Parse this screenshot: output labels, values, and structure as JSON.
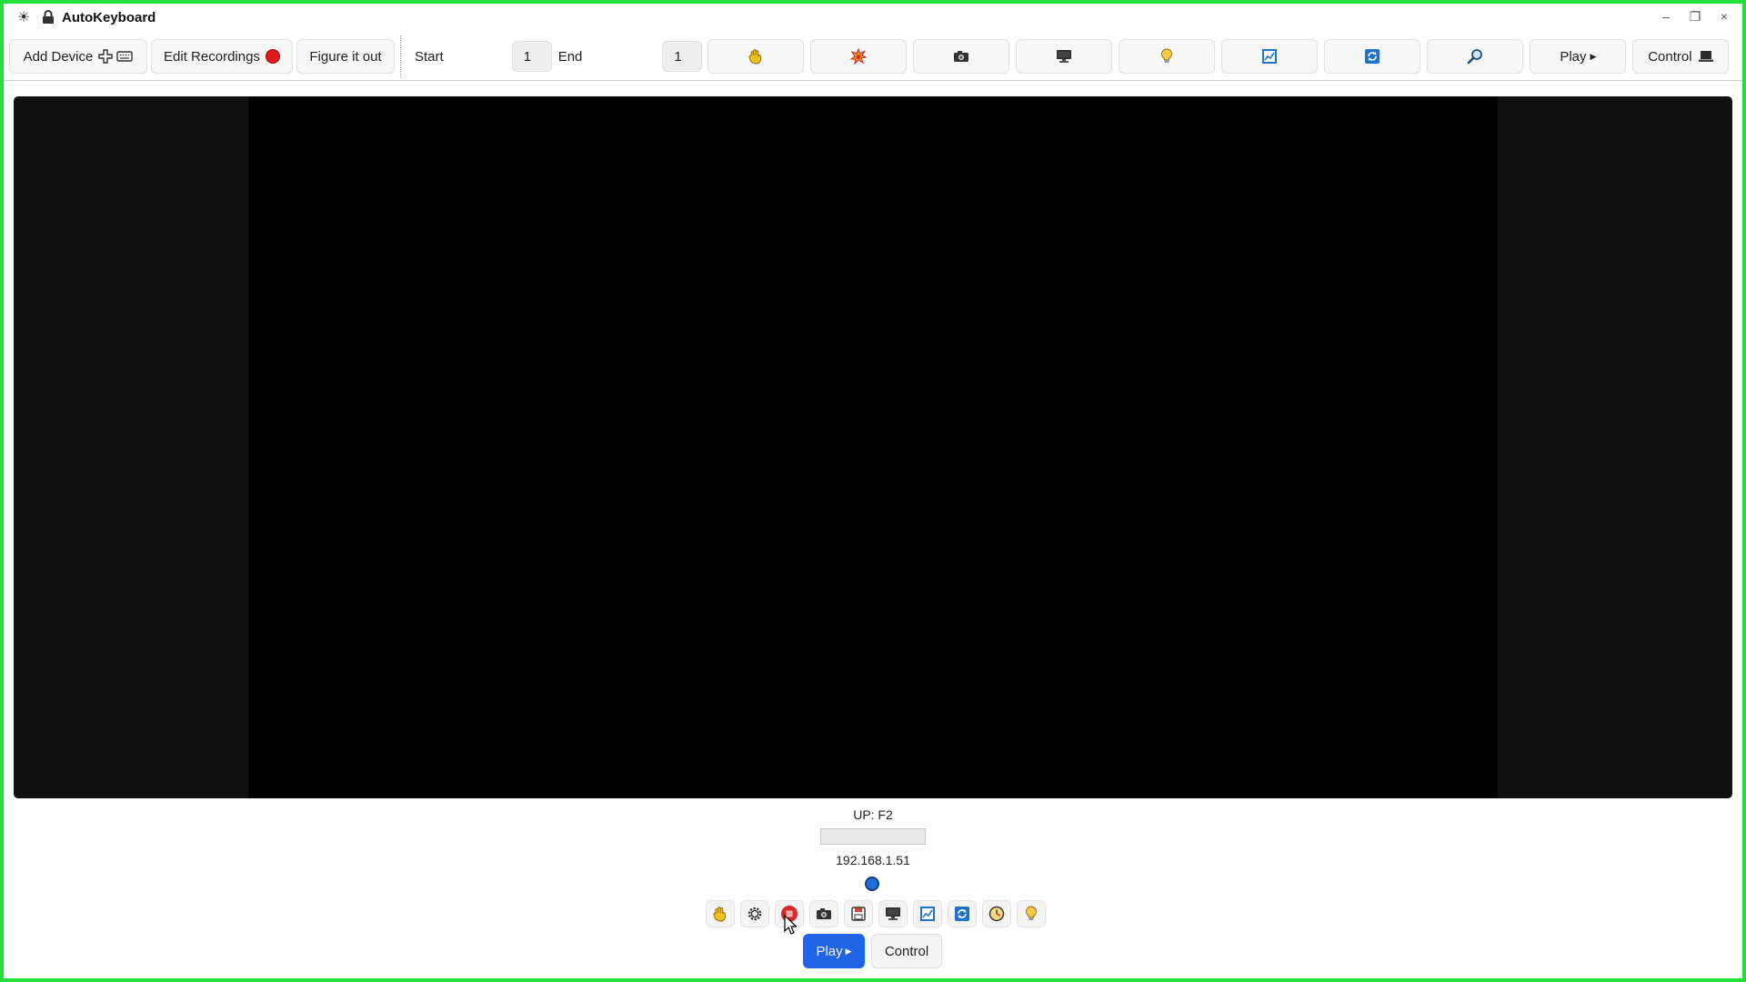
{
  "app": {
    "title": "AutoKeyboard"
  },
  "window_controls": {
    "minimize": "–",
    "restore": "❐",
    "close": "×"
  },
  "toolbar": {
    "add_device_label": "Add Device",
    "edit_recordings_label": "Edit Recordings",
    "figure_it_out_label": "Figure it out",
    "start_label": "Start",
    "start_value": "1",
    "end_label": "End",
    "end_value": "1",
    "play_label": "Play",
    "control_label": "Control",
    "icon_buttons": [
      "hand-icon",
      "explosion-icon",
      "camera-icon",
      "monitor-icon",
      "lightbulb-icon",
      "chart-icon",
      "refresh-icon",
      "magnifier-icon"
    ]
  },
  "status": {
    "key_event": "UP: F2",
    "progress": 0,
    "ip_address": "192.168.1.51"
  },
  "bottom_bar": {
    "icons": [
      "hand-icon",
      "gear-icon",
      "stop-record-icon",
      "camera-icon",
      "save-icon",
      "monitor-icon",
      "chart-icon",
      "refresh-icon",
      "clock-icon",
      "lightbulb-icon"
    ],
    "play_label": "Play",
    "control_label": "Control"
  },
  "colors": {
    "accent": "#1f63e6",
    "record": "#e01b1b",
    "frame": "#22e03a",
    "connection": "#1e6fd6"
  }
}
